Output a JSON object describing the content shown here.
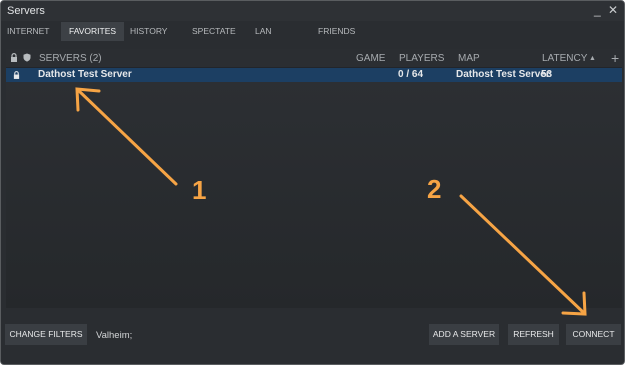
{
  "window": {
    "title": "Servers",
    "controls": "_ ✕"
  },
  "tabs": [
    {
      "label": "INTERNET",
      "active": false
    },
    {
      "label": "FAVORITES",
      "active": true
    },
    {
      "label": "HISTORY",
      "active": false
    },
    {
      "label": "SPECTATE",
      "active": false
    },
    {
      "label": "LAN",
      "active": false
    },
    {
      "label": "FRIENDS",
      "active": false
    }
  ],
  "columns": {
    "servers": "SERVERS (2)",
    "game": "GAME",
    "players": "PLAYERS",
    "map": "MAP",
    "latency": "LATENCY",
    "sort_arrow": "▲",
    "add": "+"
  },
  "rows": [
    {
      "name": "Dathost Test Server",
      "game": "",
      "players": "0 / 64",
      "map": "Dathost Test Server",
      "latency": "53"
    }
  ],
  "bottom": {
    "change_filters": "CHANGE FILTERS",
    "filter_value": "Valheim;",
    "add_server": "ADD A SERVER",
    "refresh": "REFRESH",
    "connect": "CONNECT"
  },
  "annotations": {
    "step1": "1",
    "step2": "2",
    "color": "#f6a445"
  },
  "colors": {
    "window_bg": "#2a2d31",
    "selected_row": "#1c3f63",
    "active_tab": "#3d4146"
  }
}
